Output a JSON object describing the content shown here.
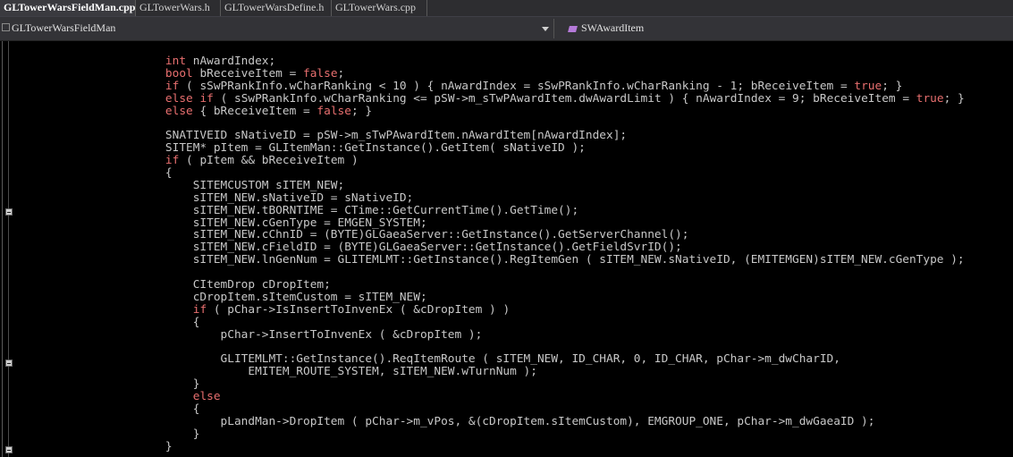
{
  "tabs": [
    {
      "label": "GLTowerWarsFieldMan.cpp",
      "active": true
    },
    {
      "label": "GLTowerWars.h",
      "active": false
    },
    {
      "label": "GLTowerWarsDefine.h",
      "active": false
    },
    {
      "label": "GLTowerWars.cpp",
      "active": false
    }
  ],
  "nav": {
    "scope_label": "GLTowerWarsFieldMan",
    "scope_icon": "class-icon",
    "member_label": "SWAwardItem",
    "member_icon": "member-function-icon"
  },
  "colors": {
    "background": "#000000",
    "keyword": "#e86f6f",
    "text": "#c8c8c8"
  },
  "code": [
    "int nAwardIndex;",
    "bool bReceiveItem = false;",
    "if ( sSwPRankInfo.wCharRanking < 10 ) { nAwardIndex = sSwPRankInfo.wCharRanking - 1; bReceiveItem = true; }",
    "else if ( sSwPRankInfo.wCharRanking <= pSW->m_sTwPAwardItem.dwAwardLimit ) { nAwardIndex = 9; bReceiveItem = true; }",
    "else { bReceiveItem = false; }",
    "",
    "SNATIVEID sNativeID = pSW->m_sTwPAwardItem.nAwardItem[nAwardIndex];",
    "SITEM* pItem = GLItemMan::GetInstance().GetItem( sNativeID );",
    "if ( pItem && bReceiveItem )",
    "{",
    "    SITEMCUSTOM sITEM_NEW;",
    "    sITEM_NEW.sNativeID = sNativeID;",
    "    sITEM_NEW.tBORNTIME = CTime::GetCurrentTime().GetTime();",
    "    sITEM_NEW.cGenType = EMGEN_SYSTEM;",
    "    sITEM_NEW.cChnID = (BYTE)GLGaeaServer::GetInstance().GetServerChannel();",
    "    sITEM_NEW.cFieldID = (BYTE)GLGaeaServer::GetInstance().GetFieldSvrID();",
    "    sITEM_NEW.lnGenNum = GLITEMLMT::GetInstance().RegItemGen ( sITEM_NEW.sNativeID, (EMITEMGEN)sITEM_NEW.cGenType );",
    "",
    "    CItemDrop cDropItem;",
    "    cDropItem.sItemCustom = sITEM_NEW;",
    "    if ( pChar->IsInsertToInvenEx ( &cDropItem ) )",
    "    {",
    "        pChar->InsertToInvenEx ( &cDropItem );",
    "",
    "        GLITEMLMT::GetInstance().ReqItemRoute ( sITEM_NEW, ID_CHAR, 0, ID_CHAR, pChar->m_dwCharID,",
    "            EMITEM_ROUTE_SYSTEM, sITEM_NEW.wTurnNum );",
    "    }",
    "    else",
    "    {",
    "        pLandMan->DropItem ( pChar->m_vPos, &(cDropItem.sItemCustom), EMGROUP_ONE, pChar->m_dwGaeaID );",
    "    }",
    "}"
  ],
  "keyword_prefixes": [
    [
      "int "
    ],
    [
      "bool ",
      "false"
    ],
    [
      "if",
      "true"
    ],
    [
      "else if",
      "true"
    ],
    [
      "else",
      "false"
    ],
    [],
    [],
    [],
    [
      "if"
    ],
    [],
    [],
    [],
    [],
    [],
    [],
    [],
    [],
    [],
    [],
    [],
    [
      "if"
    ],
    [],
    [],
    [],
    [],
    [],
    [],
    [
      "else"
    ],
    [],
    [],
    [],
    []
  ]
}
